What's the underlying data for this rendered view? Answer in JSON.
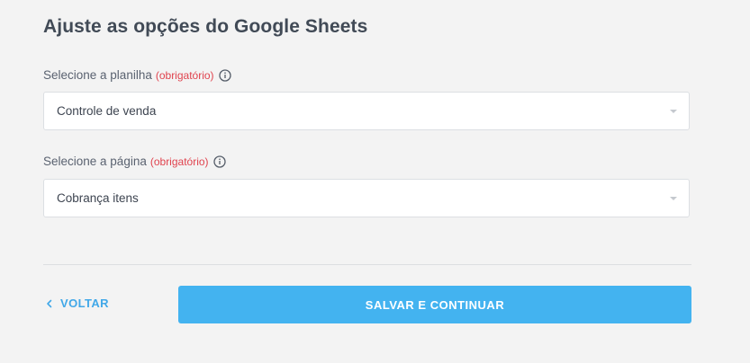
{
  "title": "Ajuste as opções do Google Sheets",
  "fields": [
    {
      "label": "Selecione a planilha",
      "required_text": "(obrigatório)",
      "info_icon": "info-circle-icon",
      "value": "Controle de venda"
    },
    {
      "label": "Selecione a página",
      "required_text": "(obrigatório)",
      "info_icon": "info-circle-icon",
      "value": "Cobrança itens"
    }
  ],
  "actions": {
    "back_label": "VOLTAR",
    "back_icon": "chevron-left-icon",
    "save_label": "SALVAR E CONTINUAR"
  },
  "colors": {
    "background": "#f3f3f3",
    "required": "#e0434e",
    "accent": "#43b3f0",
    "link": "#41a8e8"
  }
}
